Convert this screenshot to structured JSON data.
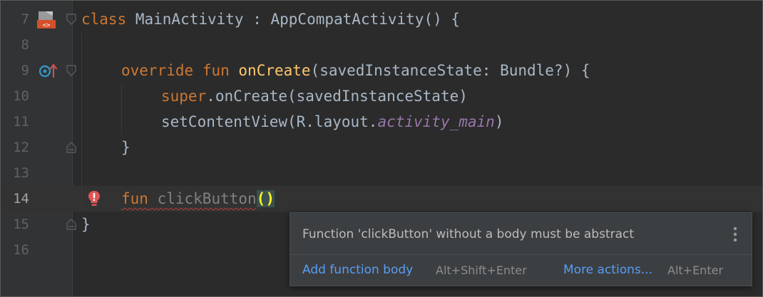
{
  "editor": {
    "lines": [
      {
        "num": "7"
      },
      {
        "num": "8"
      },
      {
        "num": "9"
      },
      {
        "num": "10"
      },
      {
        "num": "11"
      },
      {
        "num": "12"
      },
      {
        "num": "13"
      },
      {
        "num": "14"
      },
      {
        "num": "15"
      },
      {
        "num": "16"
      }
    ],
    "code": {
      "l7": {
        "kw": "class",
        "rest": " MainActivity : AppCompatActivity() {"
      },
      "l9": {
        "kw1": "override",
        "kw2": "fun",
        "fn": "onCreate",
        "rest": "(savedInstanceState: Bundle?) {"
      },
      "l10": {
        "kw": "super",
        "rest": ".onCreate(savedInstanceState)"
      },
      "l11": {
        "pre": "setContentView(R.layout.",
        "it": "activity_main",
        "post": ")"
      },
      "l12": {
        "text": "}"
      },
      "l14": {
        "kw": "fun",
        "name": "clickButton",
        "parens": "()"
      },
      "l15": {
        "text": "}"
      }
    },
    "current_line": "14"
  },
  "popup": {
    "message": "Function 'clickButton' without a body must be abstract",
    "action1": "Add function body",
    "action1_shortcut": "Alt+Shift+Enter",
    "action2": "More actions...",
    "action2_shortcut": "Alt+Enter"
  },
  "colors": {
    "background": "#2b2b2b",
    "keyword": "#cc7832",
    "function": "#ffc66d",
    "link": "#589df6",
    "error": "#bc3f3c"
  },
  "icons": [
    "android-layout-icon",
    "override-method-icon",
    "fold-icon",
    "error-bulb-icon",
    "more-options-icon"
  ]
}
